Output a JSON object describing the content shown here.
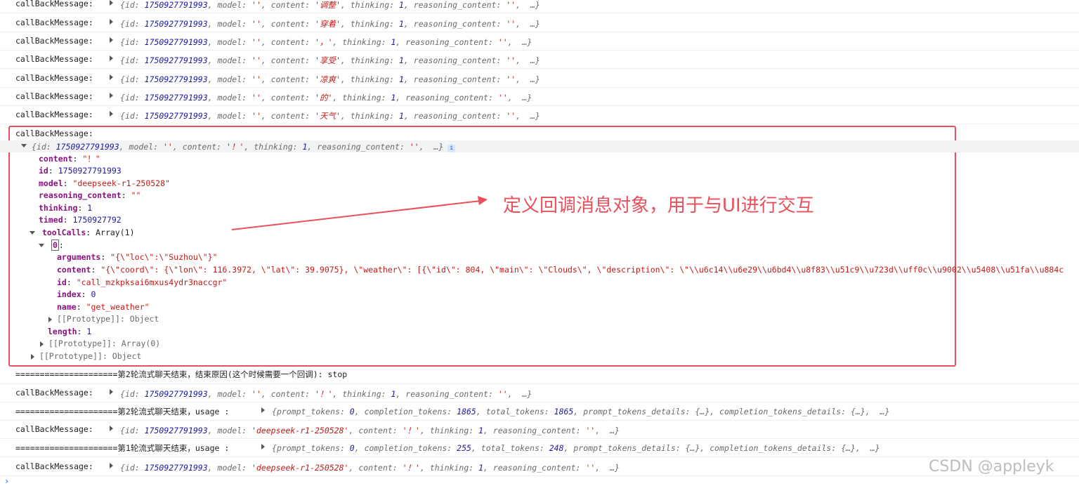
{
  "log": {
    "label": "callBackMessage:",
    "id": "1750927791993",
    "rows_top": [
      {
        "content": "'调整'"
      },
      {
        "content": "'穿着'"
      },
      {
        "content": "'，'"
      },
      {
        "content": "'享受'"
      },
      {
        "content": "'凉爽'"
      },
      {
        "content": "'的'"
      },
      {
        "content": "'天气'"
      }
    ],
    "expanded": {
      "label": "callBackMessage:",
      "summary_content": "'！'",
      "content_val": "\"！\"",
      "id_val": "1750927791993",
      "model_val": "\"deepseek-r1-250528\"",
      "reasoning_val": "\"\"",
      "thinking_val": "1",
      "timed_val": "1750927792",
      "toolcalls_val": "Array(1)",
      "index0": "0",
      "arguments_val": "\"{\\\"loc\\\":\\\"Suzhou\\\"}\"",
      "content2_val": "\"{\\\"coord\\\": {\\\"lon\\\": 116.3972, \\\"lat\\\": 39.9075}, \\\"weather\\\": [{\\\"id\\\": 804, \\\"main\\\": \\\"Clouds\\\", \\\"description\\\": \\\"\\\\u6c14\\\\u6e29\\\\u6bd4\\\\u8f83\\\\u51c9\\\\u723d\\\\uff0c\\\\u9002\\\\u5408\\\\u51fa\\\\u884c",
      "id2_val": "\"call_mzkpksai6mxus4ydr3naccgr\"",
      "index_val": "0",
      "name_val": "\"get_weather\"",
      "proto_obj": "[[Prototype]]: Object",
      "length_val": "1",
      "proto_arr": "[[Prototype]]: Array(0)",
      "proto_obj2": "[[Prototype]]: Object"
    },
    "sep1": "=====================第2轮流式聊天结束，结束原因(这个时候需要一个回调): stop",
    "row_after": {
      "content": "'！'"
    },
    "usage2_label": "=====================第2轮流式聊天结束，usage :",
    "usage2": {
      "prompt_tokens": "0",
      "completion_tokens": "1865",
      "total_tokens": "1865"
    },
    "row_model": {
      "model": "'deepseek-r1-250528'",
      "content": "'！'"
    },
    "usage1_label": "=====================第1轮流式聊天结束，usage :",
    "usage1": {
      "prompt_tokens": "0",
      "completion_tokens": "255",
      "total_tokens": "248"
    },
    "row_model2": {
      "model": "'deepseek-r1-250528'",
      "content": "'！'"
    }
  },
  "annotation": "定义回调消息对象，用于与UI进行交互",
  "watermark": "CSDN @appleyk",
  "colors": {
    "annotation": "#e8505b",
    "string": "#c41a16",
    "number": "#1a1aa6",
    "prop": "#881280"
  }
}
